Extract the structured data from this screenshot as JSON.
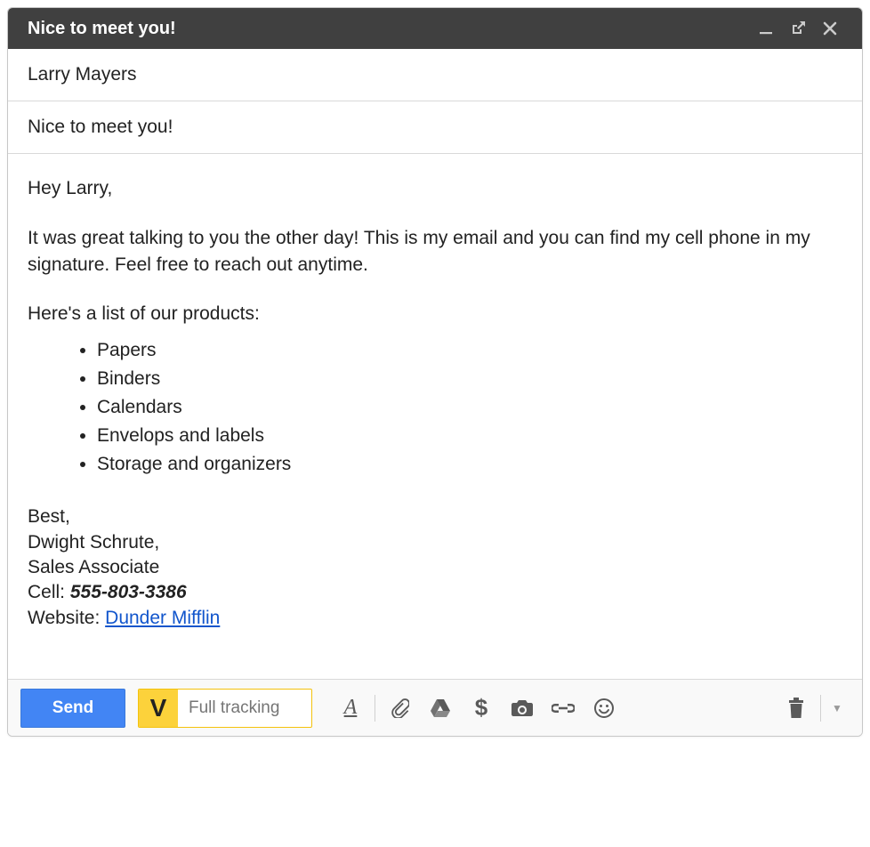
{
  "window": {
    "title": "Nice to meet you!"
  },
  "fields": {
    "to": "Larry Mayers",
    "subject": "Nice to meet you!"
  },
  "body": {
    "greeting": "Hey Larry,",
    "para1": "It was great talking to you the other day! This is my email and you can find my cell phone in my signature. Feel free to reach out anytime.",
    "para2": "Here's a list of our products:",
    "products": [
      "Papers",
      "Binders",
      "Calendars",
      "Envelops and labels",
      "Storage and organizers"
    ]
  },
  "signature": {
    "closing": "Best,",
    "name": "Dwight Schrute,",
    "title": "Sales Associate",
    "cell_label": "Cell: ",
    "cell": "555-803-3386",
    "website_label": "Website: ",
    "website_text": "Dunder Mifflin"
  },
  "toolbar": {
    "send_label": "Send",
    "vocus_badge": "V",
    "tracking_placeholder": "Full tracking"
  }
}
